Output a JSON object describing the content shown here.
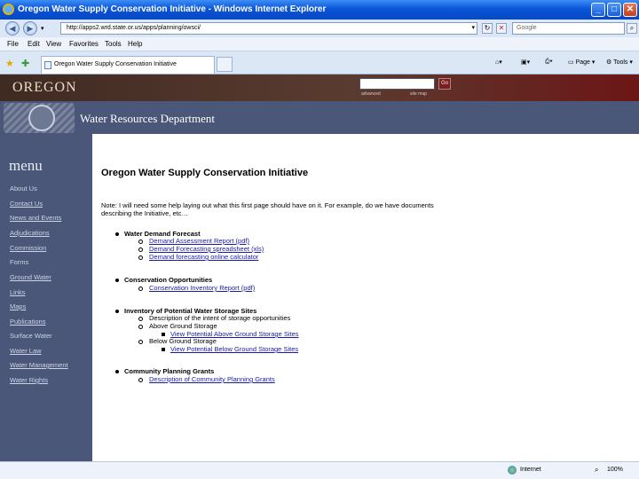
{
  "window": {
    "title": "Oregon Water Supply Conservation Initiative - Windows Internet Explorer"
  },
  "browser": {
    "address": "http://apps2.wrd.state.or.us/apps/planning/owsci/",
    "search_placeholder": "Google",
    "menu": [
      "File",
      "Edit",
      "View",
      "Favorites",
      "Tools",
      "Help"
    ],
    "tab_title": "Oregon Water Supply Conservation Initiative",
    "page_menu": "Page",
    "tools_menu": "Tools",
    "status_zone": "Internet",
    "zoom": "100%"
  },
  "site": {
    "logo": "OREGON",
    "search_go": "Go",
    "advanced": "advanced",
    "site_map": "site map",
    "department": "Water Resources Department",
    "menu_title": "menu",
    "nav": [
      "About Us",
      "Contact Us",
      "News and Events",
      "Adjudications",
      "Commission",
      "Forms",
      "Ground Water",
      "Links",
      "Maps",
      "Publications",
      "Surface Water",
      "Water Law",
      "Water Management",
      "Water Rights"
    ]
  },
  "content": {
    "title": "Oregon Water Supply Conservation Initiative",
    "note": "Note: I will need some help laying out what this first page should have on it. For example, do we have documents describing the Initiative, etc…",
    "sections": [
      {
        "heading": "Water Demand Forecast",
        "items": [
          "Demand Assessment Report (pdf)",
          "Demand Forecasting spreadsheet (xls)",
          "Demand forecasting online calculator"
        ]
      },
      {
        "heading": "Conservation Opportunities",
        "items": [
          "Conservation Inventory Report (pdf)"
        ]
      },
      {
        "heading": "Inventory of Potential Water Storage Sites",
        "items": [
          "Description of the intent of storage opportunities",
          "Above Ground Storage",
          "View Potential Above Ground Storage Sites",
          "Below Ground Storage",
          "View Potential Below Ground Storage Sites"
        ]
      },
      {
        "heading": "Community Planning Grants",
        "items": [
          "Description of Community Planning Grants"
        ]
      }
    ]
  }
}
